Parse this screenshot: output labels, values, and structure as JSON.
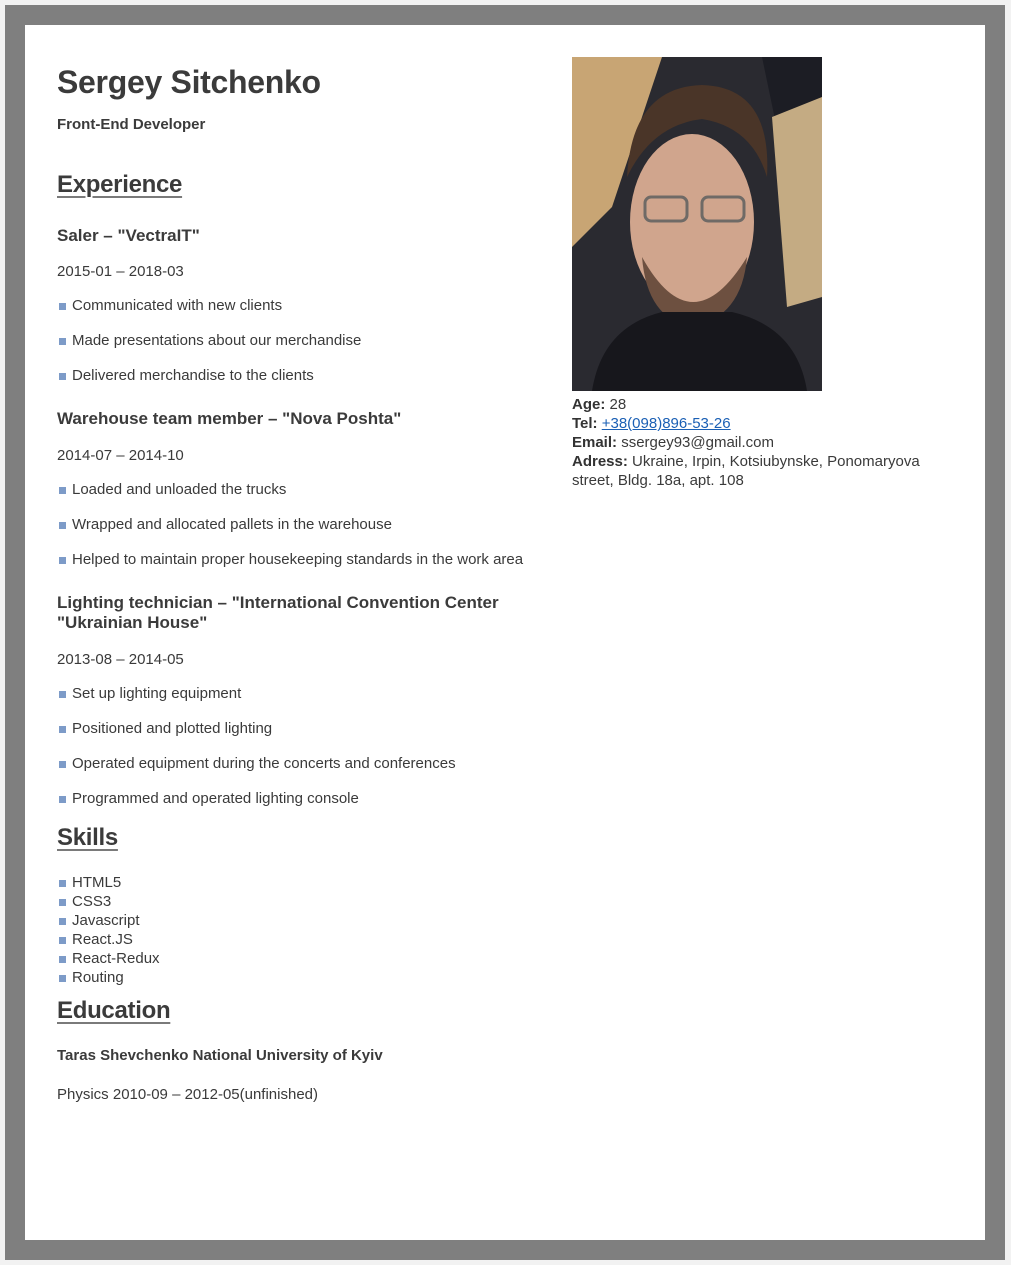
{
  "header": {
    "name": "Sergey Sitchenko",
    "role": "Front-End Developer"
  },
  "experience": {
    "title": "Experience",
    "jobs": [
      {
        "title": "Saler – \"VectraIT\"",
        "dates": "2015-01 – 2018-03",
        "duties": [
          "Communicated with new clients",
          "Made presentations about our merchandise",
          "Delivered merchandise to the clients"
        ]
      },
      {
        "title": "Warehouse team member – \"Nova Poshta\"",
        "dates": "2014-07 – 2014-10",
        "duties": [
          "Loaded and unloaded the trucks",
          "Wrapped and allocated pallets in the warehouse",
          "Helped to maintain proper housekeeping standards in the work area"
        ]
      },
      {
        "title": "Lighting technician – \"International Convention Center \"Ukrainian House\"",
        "dates": "2013-08 – 2014-05",
        "duties": [
          "Set up lighting equipment",
          "Positioned and plotted lighting",
          "Operated equipment during the concerts and conferences",
          "Programmed and operated lighting console"
        ]
      }
    ]
  },
  "skills": {
    "title": "Skills",
    "items": [
      "HTML5",
      "CSS3",
      "Javascript",
      "React.JS",
      "React-Redux",
      "Routing"
    ]
  },
  "education": {
    "title": "Education",
    "school": "Taras Shevchenko National University of Kyiv",
    "detail": "Physics 2010-09 – 2012-05(unfinished)"
  },
  "contact": {
    "age_label": "Age:",
    "age": "28",
    "tel_label": "Tel:",
    "tel": "+38(098)896-53-26",
    "email_label": "Email:",
    "email": "ssergey93@gmail.com",
    "address_label": "Adress:",
    "address": "Ukraine, Irpin, Kotsiubynske, Ponomaryova street, Bldg. 18a, apt. 108"
  }
}
